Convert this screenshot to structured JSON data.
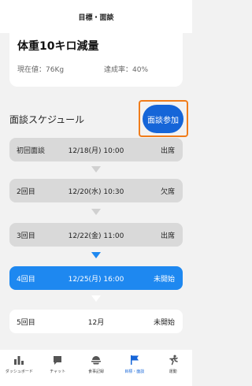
{
  "header": {
    "title": "目標・面談"
  },
  "goal": {
    "title": "体重10キロ減量",
    "current_value": "現在値：76Kg",
    "achievement_rate": "達成率：40%"
  },
  "schedule": {
    "section_title": "面談スケジュール",
    "join_button_label": "面談参加",
    "rows": [
      {
        "label": "初回面談",
        "date": "12/18(月) 10:00",
        "status": "出席"
      },
      {
        "label": "2回目",
        "date": "12/20(水) 10:30",
        "status": "欠席"
      },
      {
        "label": "3回目",
        "date": "12/22(金) 11:00",
        "status": "出席"
      },
      {
        "label": "4回目",
        "date": "12/25(月) 16:00",
        "status": "未開始"
      },
      {
        "label": "5回目",
        "date": "12月",
        "status": "未開始"
      }
    ]
  },
  "bottom_nav": {
    "items": [
      {
        "label": "ダッシュボード",
        "icon": "bar-chart-icon"
      },
      {
        "label": "チャット",
        "icon": "chat-icon"
      },
      {
        "label": "食事記録",
        "icon": "meal-icon"
      },
      {
        "label": "目標・面談",
        "icon": "flag-icon",
        "active": true
      },
      {
        "label": "運動",
        "icon": "running-icon"
      }
    ]
  },
  "colors": {
    "accent": "#1565d8",
    "current_row": "#1e88f0",
    "highlight": "#f07c1a"
  }
}
